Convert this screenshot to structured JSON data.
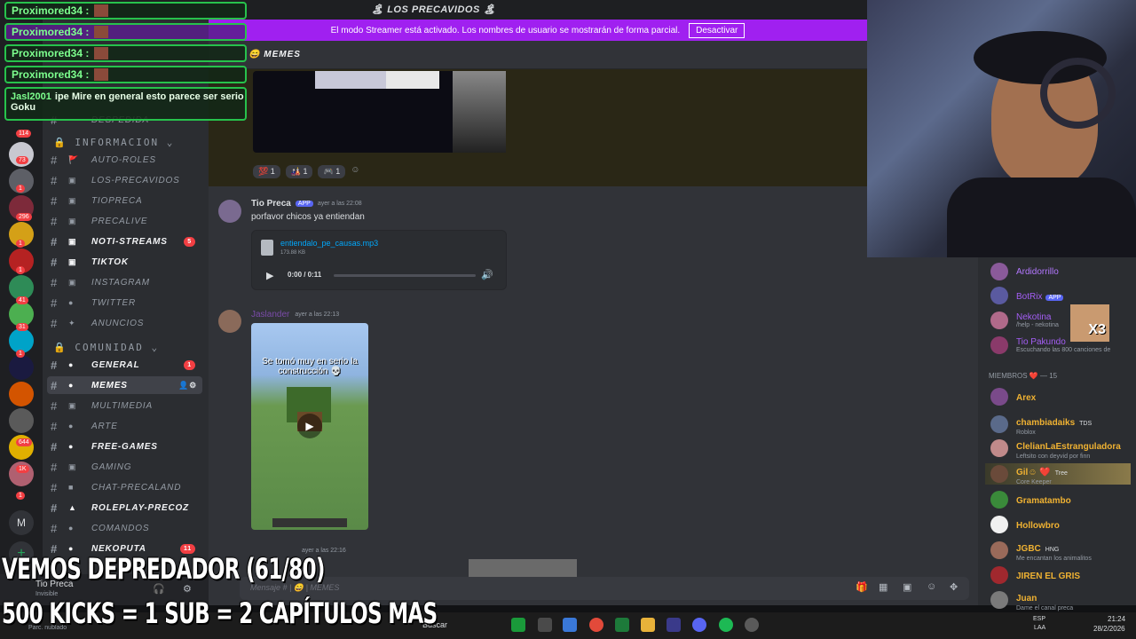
{
  "titlebar": {
    "title": "🏝 LOS PRECAVIDOS 🏝"
  },
  "streamer_banner": {
    "text": "El modo Streamer está activado. Los nombres de usuario se mostrarán de forma parcial.",
    "button": "Desactivar"
  },
  "chat_header": {
    "channel": "MEMES"
  },
  "categories": {
    "info": "INFORMACION",
    "comunidad": "COMUNIDAD"
  },
  "channels": [
    {
      "label": "DESPEDIDA",
      "emoji": "",
      "count": ""
    },
    {
      "label": "AUTO-ROLES",
      "emoji": "🚩",
      "count": ""
    },
    {
      "label": "LOS-PRECAVIDOS",
      "emoji": "▣",
      "count": ""
    },
    {
      "label": "TIOPRECA",
      "emoji": "▣",
      "count": ""
    },
    {
      "label": "PRECALIVE",
      "emoji": "▣",
      "count": ""
    },
    {
      "label": "NOTI-STREAMS",
      "emoji": "▣",
      "count": "5"
    },
    {
      "label": "TIKTOK",
      "emoji": "▣",
      "count": ""
    },
    {
      "label": "INSTAGRAM",
      "emoji": "▣",
      "count": ""
    },
    {
      "label": "TWITTER",
      "emoji": "●",
      "count": ""
    },
    {
      "label": "ANUNCIOS",
      "emoji": "✦",
      "count": ""
    },
    {
      "label": "GENERAL",
      "emoji": "●",
      "count": "1"
    },
    {
      "label": "MEMES",
      "emoji": "●",
      "count": ""
    },
    {
      "label": "MULTIMEDIA",
      "emoji": "▣",
      "count": ""
    },
    {
      "label": "ARTE",
      "emoji": "●",
      "count": ""
    },
    {
      "label": "FREE-GAMES",
      "emoji": "●",
      "count": ""
    },
    {
      "label": "GAMING",
      "emoji": "▣",
      "count": ""
    },
    {
      "label": "CHAT-PRECALAND",
      "emoji": "■",
      "count": ""
    },
    {
      "label": "ROLEPLAY-PRECOZ",
      "emoji": "▲",
      "count": ""
    },
    {
      "label": "COMANDOS",
      "emoji": "●",
      "count": ""
    },
    {
      "label": "NEKOPUTA",
      "emoji": "●",
      "count": "11"
    }
  ],
  "server_badges": [
    "114",
    "73",
    "1",
    "296",
    "1",
    "1",
    "41",
    "31",
    "1",
    "644",
    "1K",
    "1"
  ],
  "reactions": [
    "1",
    "1",
    "1"
  ],
  "message1": {
    "author": "Tio Preca",
    "tag": "APP",
    "time": "ayer a las 22:08",
    "text": "porfavor chicos ya entiendan",
    "file_name": "entiendalo_pe_causas.mp3",
    "file_size": "173.88 KB",
    "audio_time": "0:00 / 0:11"
  },
  "message2": {
    "author": "Jaslander",
    "time": "ayer a las 22:13",
    "video_caption": "Se tomó muy en serio la construcción 💀"
  },
  "message3": {
    "time": "ayer a las 22:16"
  },
  "input": {
    "placeholder": "Mensaje # | 😄 | MEMES"
  },
  "user_panel": {
    "name": "Tio Preca",
    "status": "Invisible"
  },
  "members": {
    "top": [
      {
        "name": "Ardidorrillo",
        "status": "",
        "color": "#b377ff"
      },
      {
        "name": "BotRix",
        "status": "",
        "tag": "APP",
        "color": "#a45ef5"
      },
      {
        "name": "Nekotina",
        "status": "/help - nekotina",
        "color": "#a45ef5"
      },
      {
        "name": "Tio Pakundo",
        "status": "Escuchando las 800 canciones de",
        "color": "#a45ef5"
      }
    ],
    "group_label": "MIEMBROS ❤️ — 15",
    "list": [
      {
        "name": "Arex",
        "status": "",
        "color": "#f0b232"
      },
      {
        "name": "chambiadaiks",
        "status": "Roblox",
        "tag": "TDS",
        "color": "#f0b232"
      },
      {
        "name": "ClelianLaEstranguladora",
        "status": "Leftsito con deyvid por finn",
        "color": "#f0b232"
      },
      {
        "name": "Gil☺ ❤️",
        "status": "Core Keeper",
        "tag": "Tree",
        "color": "#f0b232"
      },
      {
        "name": "Gramatambo",
        "status": "",
        "color": "#f0b232"
      },
      {
        "name": "Hollowbro",
        "status": "",
        "color": "#f0b232"
      },
      {
        "name": "JGBC",
        "status": "Me encantan los animalitos",
        "tag": "HNG",
        "color": "#f0b232"
      },
      {
        "name": "JIREN EL GRIS",
        "status": "",
        "color": "#f0b232"
      },
      {
        "name": "Juan",
        "status": "Dame el canal preca",
        "color": "#f0b232"
      }
    ]
  },
  "x3_badge": "X3",
  "overlay_chat": [
    {
      "user": "Proximored34 :",
      "text": ""
    },
    {
      "user": "Proximored34 :",
      "text": ""
    },
    {
      "user": "Proximored34 :",
      "text": ""
    },
    {
      "user": "Proximored34 :",
      "text": ""
    },
    {
      "user": "Jasl2001",
      "text": "ipe Mire en general esto parece ser serio Goku"
    }
  ],
  "captions": {
    "line1": "VEMOS DEPREDADOR (61/80)",
    "line2": "500 KICKS = 1 SUB = 2 CAPÍTULOS MAS"
  },
  "taskbar": {
    "search": "Buscar",
    "lang": "ESP",
    "lang2": "LAA",
    "time": "21:24",
    "date": "28/2/2026"
  },
  "parc_label": "Parc. nublado"
}
